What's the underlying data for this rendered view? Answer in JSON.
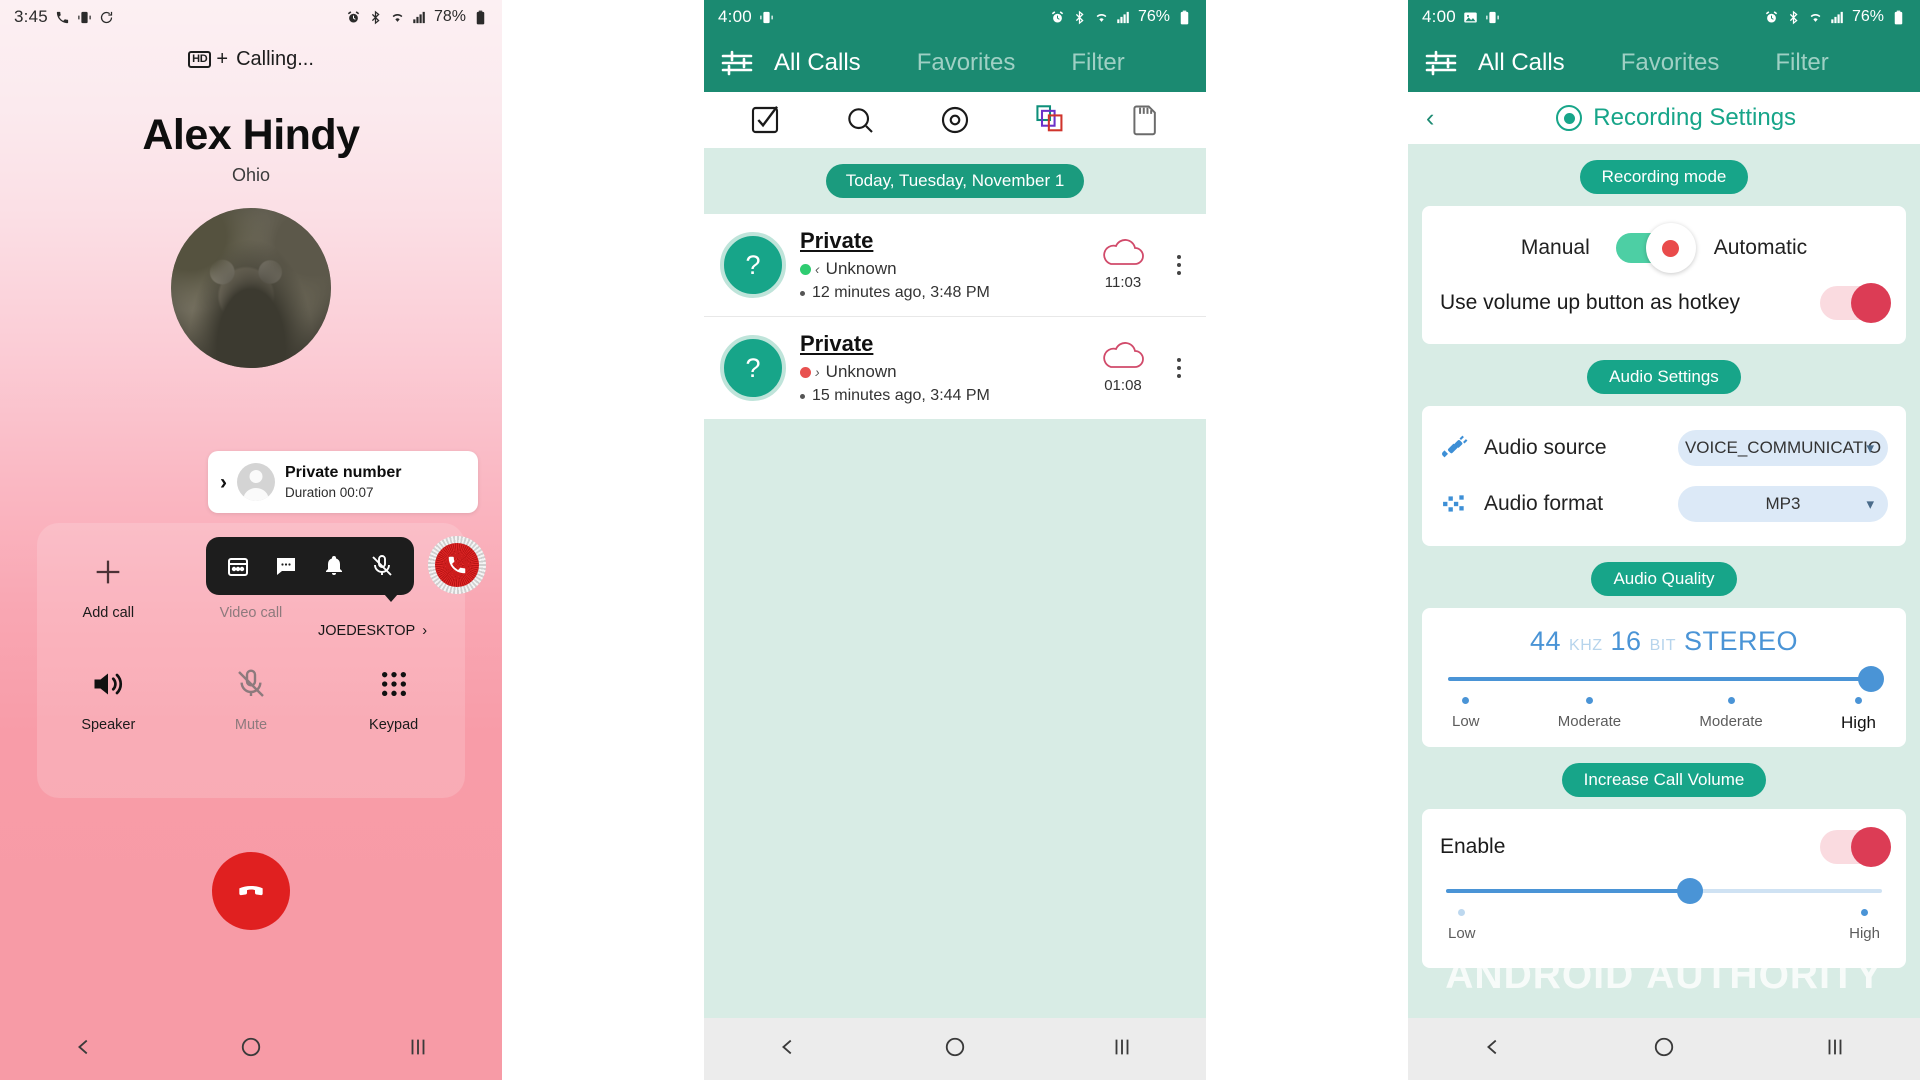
{
  "panel_call": {
    "status_bar": {
      "time": "3:45",
      "left_icons": [
        "phone-icon",
        "vibrate-icon",
        "sync-icon"
      ],
      "right_icons": [
        "alarm-icon",
        "bluetooth-icon",
        "wifi-icon",
        "signal-icon"
      ],
      "battery": "78%"
    },
    "hd_badge": "HD",
    "hd_plus": "+",
    "call_state": "Calling...",
    "caller_name": "Alex Hindy",
    "caller_location": "Ohio",
    "private_card": {
      "title": "Private number",
      "duration": "Duration 00:07"
    },
    "floating_bar_icons": [
      "calendar-icon",
      "message-icon",
      "bell-icon",
      "mic-off-icon"
    ],
    "record_badge": "phone-record-icon",
    "device_label": "JOEDESKTOP",
    "controls_top": [
      {
        "label": "Add call",
        "icon": "plus-icon",
        "dim": false
      },
      {
        "label": "Video call",
        "icon": "video-icon",
        "dim": true
      }
    ],
    "controls_bottom": [
      {
        "label": "Speaker",
        "icon": "speaker-icon",
        "dim": false
      },
      {
        "label": "Mute",
        "icon": "mic-off-icon",
        "dim": true
      },
      {
        "label": "Keypad",
        "icon": "keypad-icon",
        "dim": false
      }
    ],
    "end_call": "end-call-icon",
    "nav": [
      "back",
      "home",
      "recents"
    ],
    "colors": {
      "end_call_red": "#e02020",
      "bg_top": "#fcf0f3",
      "bg_bottom": "#f79ba6"
    }
  },
  "panel_calls": {
    "status_bar": {
      "time": "4:00",
      "left_icons": [
        "vibrate-icon"
      ],
      "battery": "76%"
    },
    "tabs": [
      {
        "label": "All Calls",
        "active": true
      },
      {
        "label": "Favorites",
        "active": false
      },
      {
        "label": "Filter",
        "active": false
      }
    ],
    "toolbar_icons": [
      "select-check-icon",
      "search-icon",
      "record-icon",
      "copy-layers-icon",
      "sd-card-icon"
    ],
    "date_chip": "Today, Tuesday, November 1",
    "calls": [
      {
        "avatar": "?",
        "name": "Private",
        "status": "Unknown",
        "direction": "incoming",
        "dot_color": "green",
        "time": "12 minutes ago, 3:48 PM",
        "duration": "11:03",
        "cloud": "cloud-icon",
        "menu": "kebab-icon"
      },
      {
        "avatar": "?",
        "name": "Private",
        "status": "Unknown",
        "direction": "outgoing",
        "dot_color": "red",
        "time": "15 minutes ago, 3:44 PM",
        "duration": "01:08",
        "cloud": "cloud-icon",
        "menu": "kebab-icon"
      }
    ],
    "colors": {
      "header_teal": "#1b8a71",
      "chip_teal": "#1b9b7e",
      "avatar_teal": "#17a589",
      "body_bg": "#d8ece5"
    }
  },
  "panel_settings": {
    "status_bar": {
      "time": "4:00",
      "left_icons": [
        "image-icon",
        "vibrate-icon"
      ],
      "battery": "76%"
    },
    "tabs": [
      {
        "label": "All Calls",
        "active": true
      },
      {
        "label": "Favorites",
        "active": false
      },
      {
        "label": "Filter",
        "active": false
      }
    ],
    "back": "back-chevron-icon",
    "title": "Recording Settings",
    "sections": {
      "recording_mode": {
        "chip": "Recording mode",
        "left_label": "Manual",
        "right_label": "Automatic",
        "selected": "Manual",
        "hotkey_label": "Use volume up button as hotkey",
        "hotkey_enabled": true
      },
      "audio_settings": {
        "chip": "Audio Settings",
        "rows": [
          {
            "icon": "plug-icon",
            "label": "Audio source",
            "value": "VOICE_COMMUNICATIO"
          },
          {
            "icon": "waveform-icon",
            "label": "Audio format",
            "value": "MP3"
          }
        ]
      },
      "audio_quality": {
        "chip": "Audio Quality",
        "rate": "44",
        "rate_unit": "KHZ",
        "depth": "16",
        "depth_unit": "BIT",
        "channels": "STEREO",
        "slider_percent": 100,
        "ticks": [
          "Low",
          "Moderate",
          "Moderate",
          "High"
        ]
      },
      "increase_call_volume": {
        "chip": "Increase Call Volume",
        "enable_label": "Enable",
        "enabled": true,
        "slider_percent": 56,
        "ticks": [
          "Low",
          "High"
        ]
      }
    },
    "watermark": {
      "part1": "ANDROID",
      "part2": "AUTHORITY"
    },
    "colors": {
      "accent_teal": "#17a589",
      "slider_blue": "#4a94d6",
      "toggle_red": "#dc3c55"
    }
  }
}
